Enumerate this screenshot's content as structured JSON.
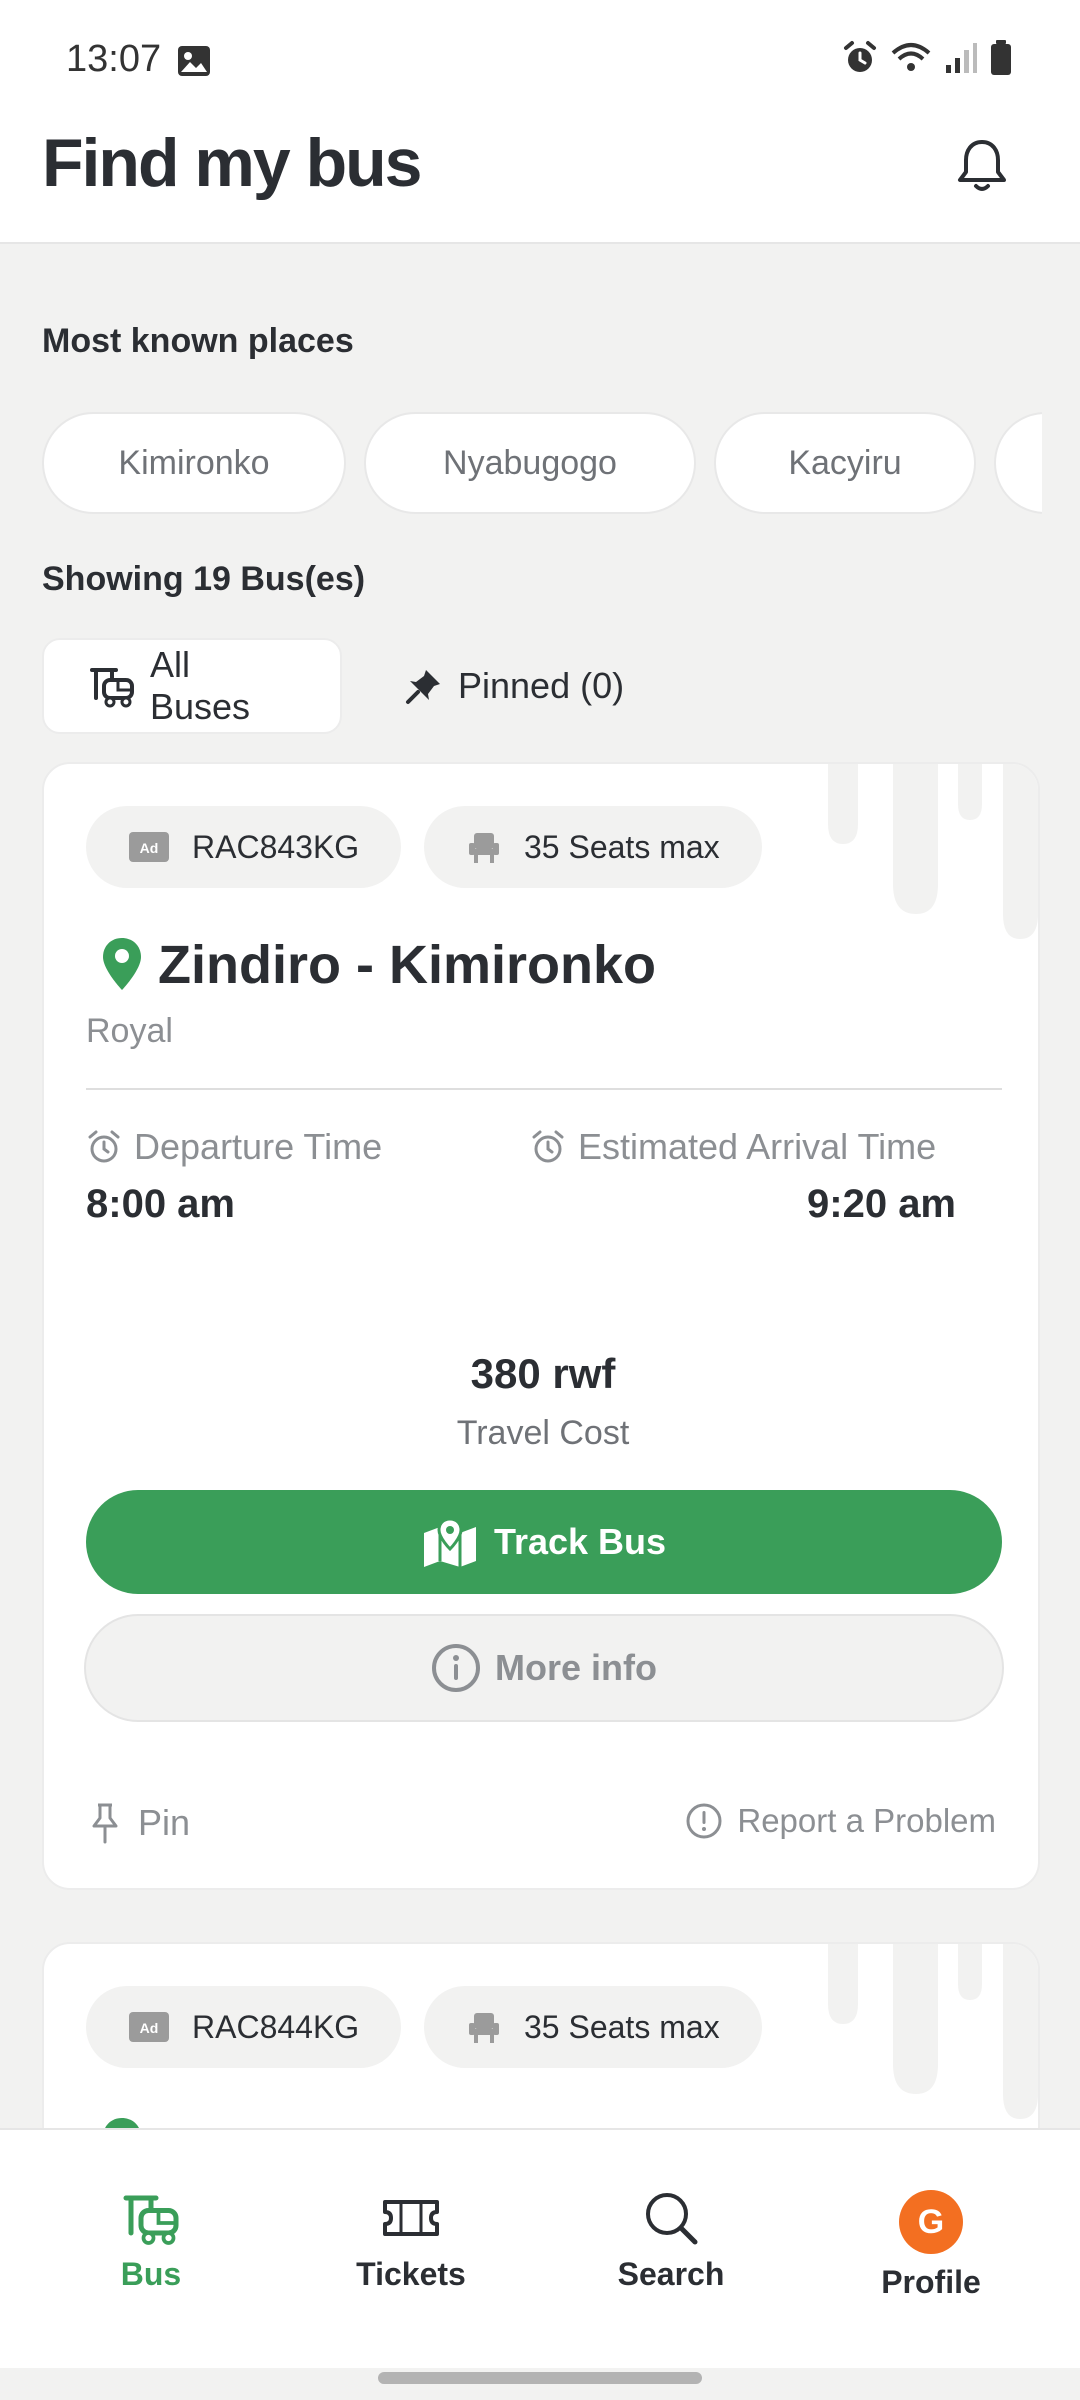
{
  "status_bar": {
    "time": "13:07"
  },
  "header": {
    "title": "Find my bus",
    "notification_icon": "bell-icon"
  },
  "places": {
    "title": "Most known places",
    "items": [
      "Kimironko",
      "Nyabugogo",
      "Kacyiru"
    ]
  },
  "results": {
    "summary": "Showing 19 Bus(es)"
  },
  "tabs": [
    {
      "label": "All Buses",
      "icon": "bus-icon",
      "active": true
    },
    {
      "label": "Pinned (0)",
      "icon": "pin-icon",
      "active": false
    }
  ],
  "buses": [
    {
      "plate": "RAC843KG",
      "seats": "35 Seats max",
      "route": "Zindiro - Kimironko",
      "operator": "Royal",
      "departure_label": "Departure Time",
      "departure_time": "8:00 am",
      "arrival_label": "Estimated Arrival Time",
      "arrival_time": "9:20 am",
      "price": "380 rwf",
      "price_label": "Travel Cost",
      "track_label": "Track Bus",
      "more_label": "More info",
      "pin_label": "Pin",
      "report_label": "Report a Problem"
    },
    {
      "plate": "RAC844KG",
      "seats": "35 Seats max"
    }
  ],
  "bottom_nav": [
    {
      "label": "Bus",
      "icon": "bus-icon",
      "active": true
    },
    {
      "label": "Tickets",
      "icon": "ticket-icon",
      "active": false
    },
    {
      "label": "Search",
      "icon": "search-icon",
      "active": false
    },
    {
      "label": "Profile",
      "avatar_letter": "G",
      "active": false
    }
  ],
  "colors": {
    "accent": "#3a9e59",
    "avatar": "#f36f21",
    "background": "#f2f2f1"
  }
}
